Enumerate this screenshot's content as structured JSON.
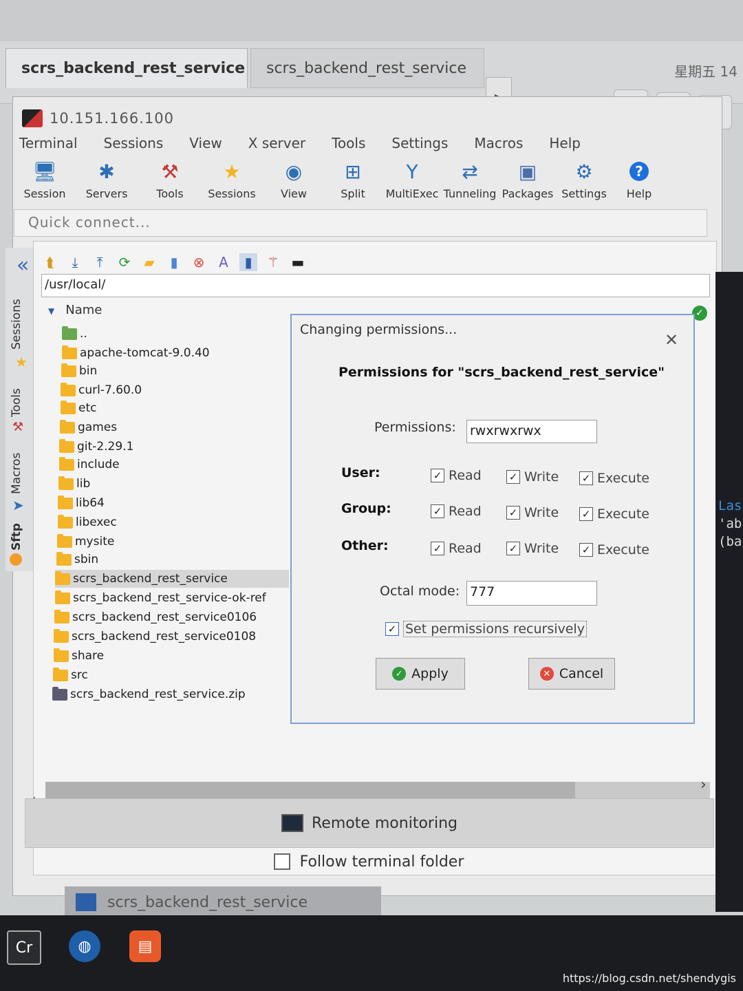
{
  "outer": {
    "tab_active": "scrs_backend_rest_service",
    "tab_second": "scrs_backend_rest_service",
    "clock": "星期五 14"
  },
  "app": {
    "title": "10.151.166.100",
    "menu": [
      "Terminal",
      "Sessions",
      "View",
      "X server",
      "Tools",
      "Settings",
      "Macros",
      "Help"
    ],
    "toolbar": [
      {
        "label": "Session",
        "icon": "session-icon"
      },
      {
        "label": "Servers",
        "icon": "servers-icon"
      },
      {
        "label": "Tools",
        "icon": "tools-icon"
      },
      {
        "label": "Sessions",
        "icon": "star-icon"
      },
      {
        "label": "View",
        "icon": "view-icon"
      },
      {
        "label": "Split",
        "icon": "split-icon"
      },
      {
        "label": "MultiExec",
        "icon": "multiexec-icon"
      },
      {
        "label": "Tunneling",
        "icon": "tunneling-icon"
      },
      {
        "label": "Packages",
        "icon": "packages-icon"
      },
      {
        "label": "Settings",
        "icon": "gear-icon"
      },
      {
        "label": "Help",
        "icon": "help-icon"
      }
    ],
    "quick_connect_placeholder": "Quick connect...",
    "side_tabs": [
      "Sessions",
      "Tools",
      "Macros",
      "Sftp"
    ]
  },
  "sftp": {
    "path": "/usr/local/",
    "column_name": "Name",
    "files": [
      {
        "name": "..",
        "type": "up"
      },
      {
        "name": "apache-tomcat-9.0.40",
        "type": "folder"
      },
      {
        "name": "bin",
        "type": "folder"
      },
      {
        "name": "curl-7.60.0",
        "type": "folder"
      },
      {
        "name": "etc",
        "type": "folder"
      },
      {
        "name": "games",
        "type": "folder"
      },
      {
        "name": "git-2.29.1",
        "type": "folder"
      },
      {
        "name": "include",
        "type": "folder"
      },
      {
        "name": "lib",
        "type": "folder"
      },
      {
        "name": "lib64",
        "type": "folder"
      },
      {
        "name": "libexec",
        "type": "folder"
      },
      {
        "name": "mysite",
        "type": "folder"
      },
      {
        "name": "sbin",
        "type": "folder"
      },
      {
        "name": "scrs_backend_rest_service",
        "type": "folder",
        "selected": true
      },
      {
        "name": "scrs_backend_rest_service-ok-ref",
        "type": "folder"
      },
      {
        "name": "scrs_backend_rest_service0106",
        "type": "folder"
      },
      {
        "name": "scrs_backend_rest_service0108",
        "type": "folder"
      },
      {
        "name": "share",
        "type": "folder"
      },
      {
        "name": "src",
        "type": "folder"
      },
      {
        "name": "scrs_backend_rest_service.zip",
        "type": "zip"
      }
    ],
    "remote_monitoring": "Remote monitoring",
    "follow_terminal": "Follow terminal folder"
  },
  "dialog": {
    "title": "Changing permissions...",
    "heading": "Permissions for \"scrs_backend_rest_service\"",
    "permissions_label": "Permissions:",
    "permissions_value": "rwxrwxrwx",
    "groups": [
      {
        "label": "User:",
        "read": "Read",
        "write": "Write",
        "execute": "Execute"
      },
      {
        "label": "Group:",
        "read": "Read",
        "write": "Write",
        "execute": "Execute"
      },
      {
        "label": "Other:",
        "read": "Read",
        "write": "Write",
        "execute": "Execute"
      }
    ],
    "octal_label": "Octal mode:",
    "octal_value": "777",
    "recursive_label": "Set permissions recursively",
    "apply": "Apply",
    "cancel": "Cancel"
  },
  "taskbar": {
    "window_title": "scrs_backend_rest_service",
    "watermark": "https://blog.csdn.net/shendygis"
  },
  "terminal_fragment": [
    "Las",
    "'ab",
    "(ba"
  ],
  "colors": {
    "accent": "#7d9fd4",
    "folder": "#f4b428",
    "ok": "#2f9a3a",
    "cancel": "#e04b3c"
  }
}
